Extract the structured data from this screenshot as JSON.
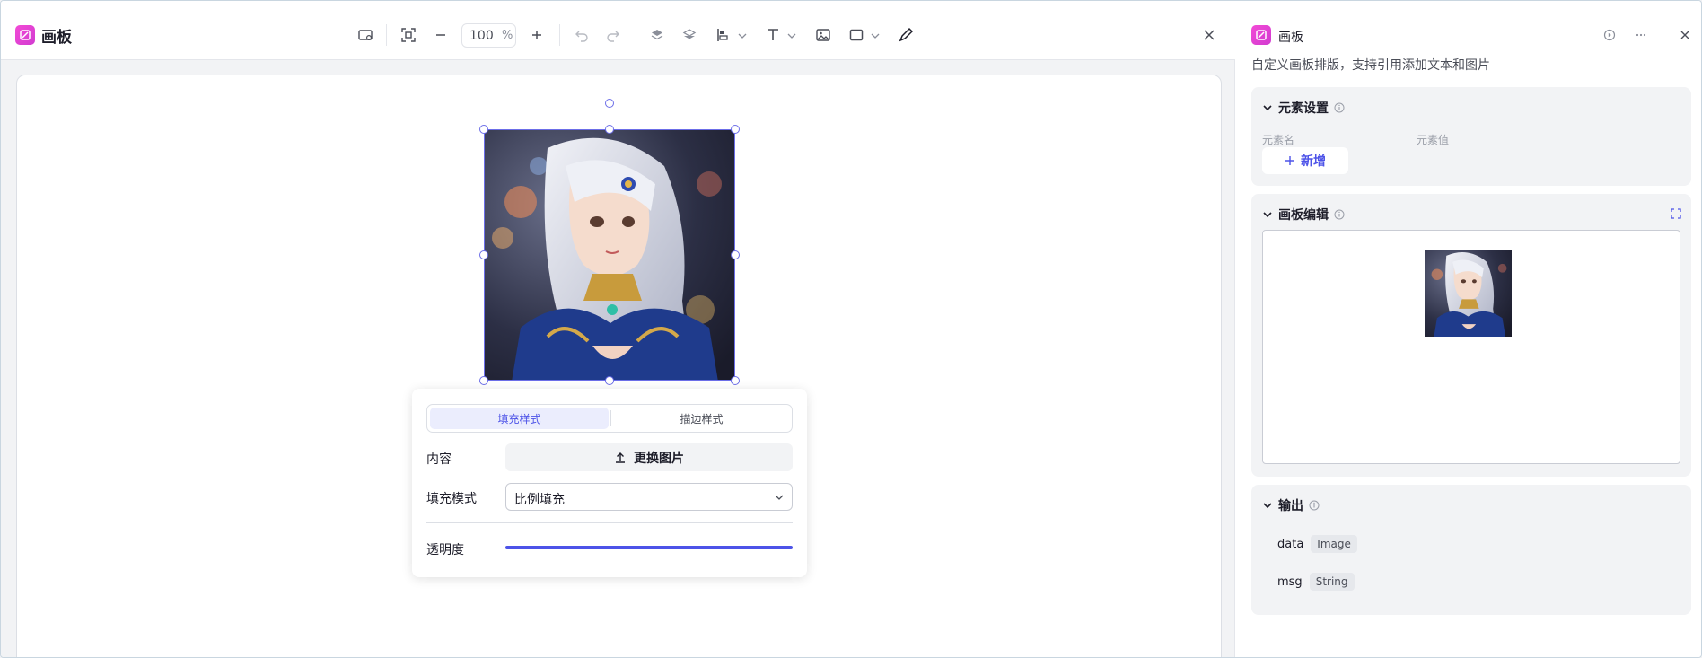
{
  "app": {
    "title": "画板"
  },
  "toolbar": {
    "zoom_value": "100",
    "zoom_unit": "%"
  },
  "style_panel": {
    "tab_fill": "填充样式",
    "tab_stroke": "描边样式",
    "content_label": "内容",
    "replace_image_label": "更换图片",
    "fill_mode_label": "填充模式",
    "fill_mode_value": "比例填充",
    "opacity_label": "透明度",
    "opacity_value": 1.0
  },
  "right_panel": {
    "title": "画板",
    "description": "自定义画板排版，支持引用添加文本和图片",
    "element_settings": {
      "title": "元素设置",
      "col_name": "元素名",
      "col_value": "元素值",
      "add_label": "新增"
    },
    "board_edit": {
      "title": "画板编辑"
    },
    "output": {
      "title": "输出",
      "rows": [
        {
          "name": "data",
          "type": "Image"
        },
        {
          "name": "msg",
          "type": "String"
        }
      ]
    }
  },
  "colors": {
    "accent": "#4d53e8",
    "brand": "#e545d4",
    "selection": "#6c6ee8"
  }
}
